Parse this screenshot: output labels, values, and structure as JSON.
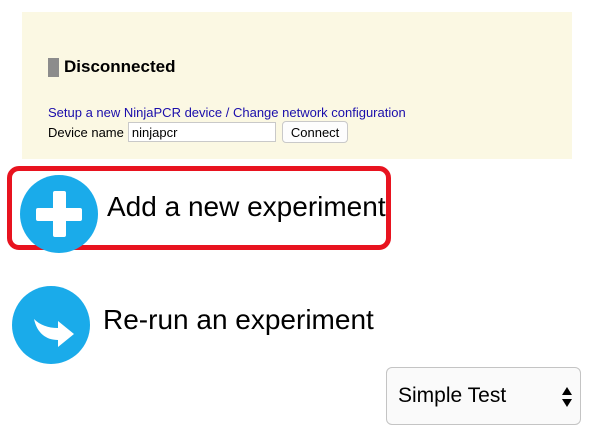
{
  "status_panel": {
    "status": "Disconnected",
    "setup_link": "Setup a new NinjaPCR device / Change network configuration",
    "device_name_label": "Device name",
    "device_name_value": "ninjapcr",
    "connect_label": "Connect"
  },
  "actions": {
    "add_label": "Add a new experiment",
    "rerun_label": "Re-run an experiment"
  },
  "experiment_select": {
    "selected": "Simple Test"
  },
  "colors": {
    "panel_bg": "#fbf8e3",
    "accent_blue": "#1aabea",
    "highlight_red": "#e8131f",
    "link": "#1a0dab"
  }
}
